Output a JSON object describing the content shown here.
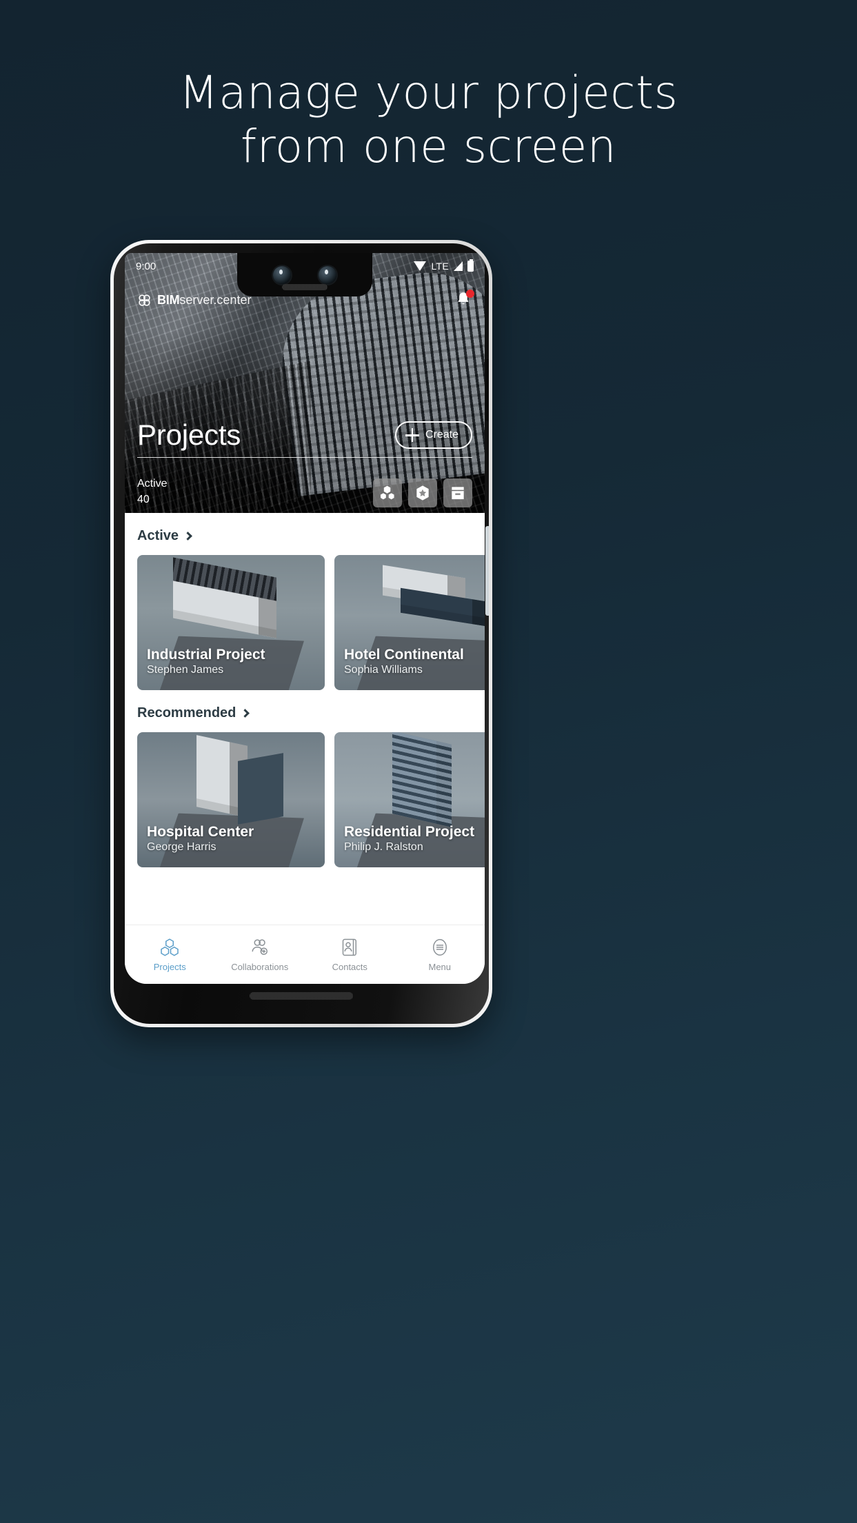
{
  "headline": {
    "line1": "Manage your projects",
    "line2": "from one screen"
  },
  "phone": {
    "status_bar": {
      "time": "9:00",
      "network": "LTE",
      "icons": [
        "wifi-icon",
        "signal-icon",
        "battery-icon"
      ]
    },
    "app": {
      "brand": {
        "bold": "BIM",
        "light": "server.center"
      },
      "notification_icon": "bell-icon",
      "hero": {
        "title": "Projects",
        "create_label": "Create",
        "create_icon": "plus-icon",
        "stat_label": "Active",
        "stat_value": "40",
        "filters": [
          {
            "name": "projects-cubes-icon",
            "label": "Projects"
          },
          {
            "name": "favorites-star-icon",
            "label": "Favorites"
          },
          {
            "name": "archive-box-icon",
            "label": "Archived"
          }
        ]
      },
      "sections": [
        {
          "title": "Active",
          "chevron_icon": "chevron-right-icon",
          "cards": [
            {
              "title": "Industrial Project",
              "author": "Stephen James"
            },
            {
              "title": "Hotel Continental",
              "author": "Sophia Williams"
            }
          ]
        },
        {
          "title": "Recommended",
          "chevron_icon": "chevron-right-icon",
          "cards": [
            {
              "title": "Hospital Center",
              "author": "George Harris"
            },
            {
              "title": "Residential Project",
              "author": "Philip J. Ralston"
            }
          ]
        }
      ],
      "tabs": [
        {
          "label": "Projects",
          "icon": "cubes-icon",
          "active": true
        },
        {
          "label": "Collaborations",
          "icon": "users-add-icon",
          "active": false
        },
        {
          "label": "Contacts",
          "icon": "address-book-icon",
          "active": false
        },
        {
          "label": "Menu",
          "icon": "hamburger-circle-icon",
          "active": false
        }
      ]
    }
  },
  "colors": {
    "background_top": "#132430",
    "background_bottom": "#1e3a4a",
    "accent_active_tab": "#5b9ec9",
    "notification_dot": "#e8272c",
    "section_heading": "#2d3c44"
  }
}
